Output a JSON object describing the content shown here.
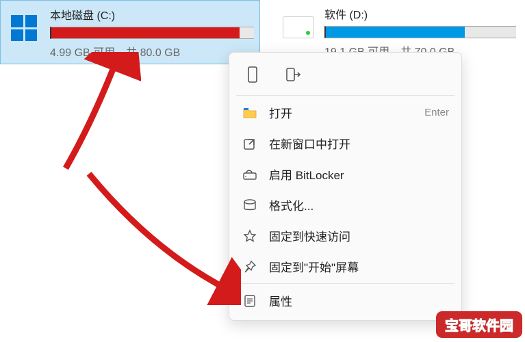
{
  "drives": {
    "c": {
      "name": "本地磁盘 (C:)",
      "stats": "4.99 GB 可用，共 80.0 GB"
    },
    "d": {
      "name": "软件 (D:)",
      "stats": "19.1 GB 可用，共 70.0 GB"
    }
  },
  "menu": {
    "open": "打开",
    "open_shortcut": "Enter",
    "open_new": "在新窗口中打开",
    "bitlocker": "启用 BitLocker",
    "format": "格式化...",
    "pin_quick": "固定到快速访问",
    "pin_start": "固定到\"开始\"屏幕",
    "properties": "属性"
  },
  "watermark": "宝哥软件园"
}
